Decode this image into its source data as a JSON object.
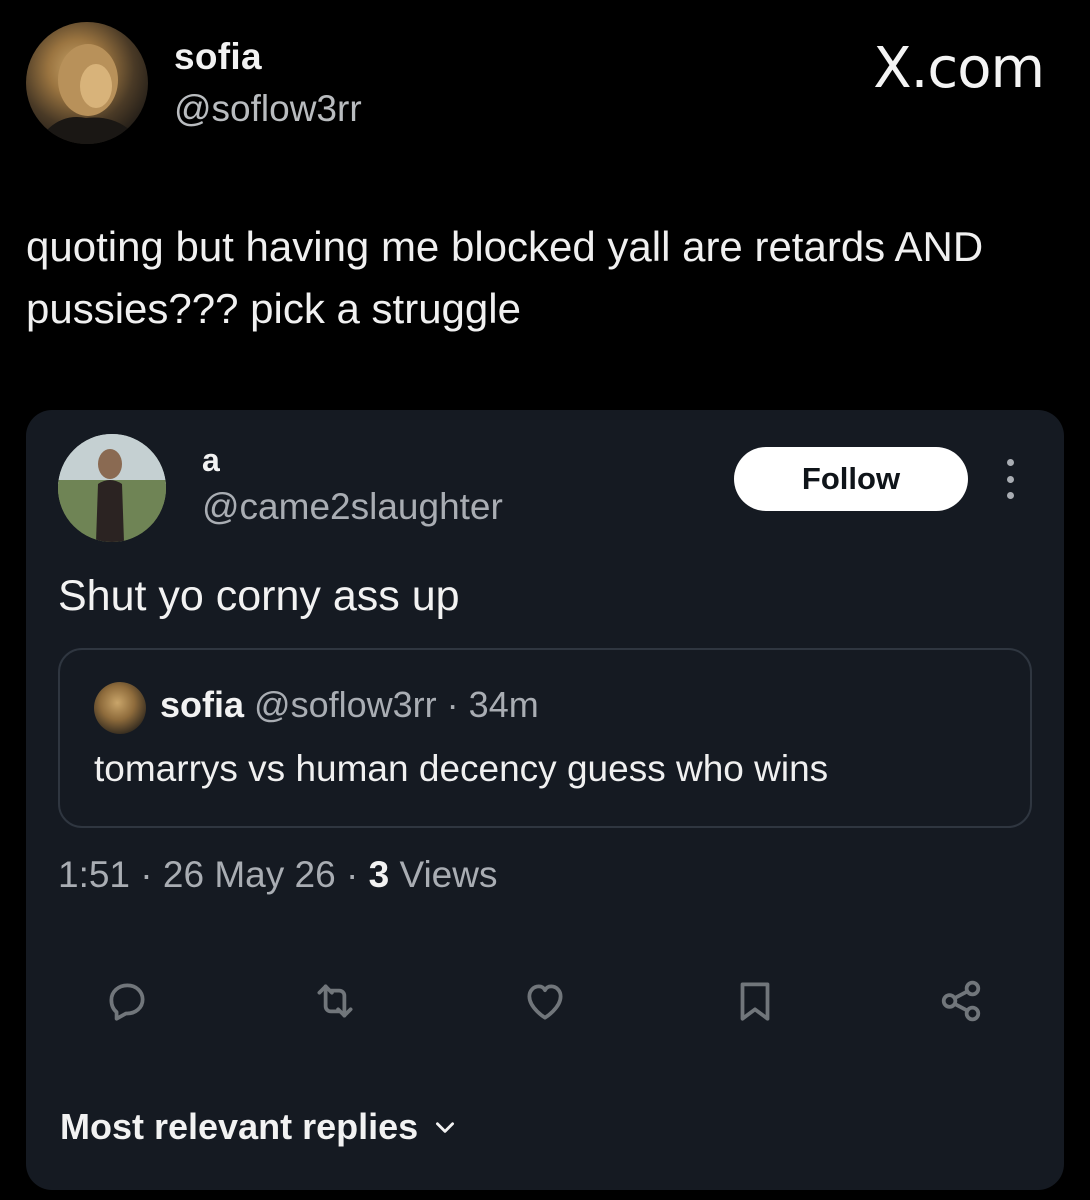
{
  "outer_post": {
    "author_name": "sofia",
    "author_handle": "@soflow3rr",
    "brand": "X.com",
    "text": "quoting but having me blocked yall are retards AND pussies??? pick a struggle"
  },
  "embedded_post": {
    "author_name": "a",
    "author_handle": "@came2slaughter",
    "follow_label": "Follow",
    "text": "Shut yo corny ass up",
    "quoted": {
      "author_name": "sofia",
      "author_handle": "@soflow3rr",
      "separator": "·",
      "age": "34m",
      "text": "tomarrys vs human decency guess who wins"
    },
    "time": "1:51",
    "date": "26 May 26",
    "views_count": "3",
    "views_label": "Views",
    "separator": "·",
    "actions": [
      "reply-icon",
      "repost-icon",
      "like-icon",
      "bookmark-icon",
      "share-icon"
    ],
    "replies_sort_label": "Most relevant replies"
  },
  "colors": {
    "page_background": "#000000",
    "card_background": "#151a22",
    "primary_text": "#f2f2f2",
    "secondary_text": "#a9adb3",
    "icon": "#71767b",
    "follow_button": "#ffffff"
  }
}
